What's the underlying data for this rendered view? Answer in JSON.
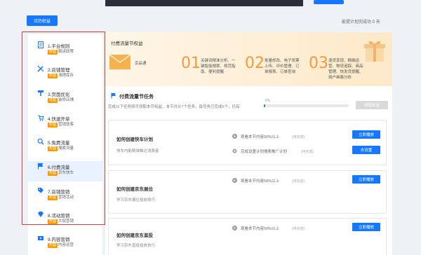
{
  "top": {
    "primary_button": "日历权益",
    "right_text": "能提计划完成功 0 天"
  },
  "sidebar": {
    "items": [
      {
        "title": "1.平台规则",
        "tag": "权益",
        "sub": "解读政策",
        "icon": "document-icon",
        "active": false
      },
      {
        "title": "2.店铺管理",
        "tag": "权益",
        "sub": "清理库存",
        "icon": "tools-icon",
        "active": false
      },
      {
        "title": "3.页面优化",
        "tag": "权益",
        "sub": "装修店铺",
        "icon": "brush-icon",
        "active": false
      },
      {
        "title": "4.快速开单",
        "tag": "权益",
        "sub": "营销获客",
        "icon": "cart-icon",
        "active": false
      },
      {
        "title": "5.免费流量",
        "tag": "权益",
        "sub": "搜索流量",
        "icon": "search-icon",
        "active": false
      },
      {
        "title": "6.付费流量",
        "tag": "权益",
        "sub": "京东快车",
        "icon": "flag-icon",
        "active": true
      },
      {
        "title": "7.店铺营销",
        "tag": "权益",
        "sub": "营销活动",
        "icon": "tag-icon",
        "active": false
      },
      {
        "title": "8.活动营销",
        "tag": "权益",
        "sub": "大促营销",
        "icon": "diamond-icon",
        "active": false
      },
      {
        "title": "9.内容营销",
        "tag": "权益",
        "sub": "内容运营",
        "icon": "video-icon",
        "active": false
      }
    ]
  },
  "hero": {
    "title": "付费流量节权益",
    "jd_label": "京品通",
    "steps": [
      {
        "num": "01",
        "text": "关键词精准分析、一键智能搜索、规范指南、便利提醒"
      },
      {
        "num": "02",
        "text": "批量修改、电子发票上传、评价管理、订单报表、订单查询"
      },
      {
        "num": "03",
        "text": "退货变现、精细运营、物流追踪、商品管理、快发货提醒、用户画像分析"
      }
    ]
  },
  "section": {
    "title": "付费流量节任务",
    "desc": "完成以下任务即可领取本节权益，本节共计7个任务，每任务已完成5个，仍有",
    "progress_label": "0%",
    "progress": 0.02,
    "claim_button": "领取权益"
  },
  "tasks": [
    {
      "title": "如何创建快车计划",
      "desc": "快车内能精准触达消费者",
      "requirements": [
        {
          "text": "观看本节内容50%以上",
          "status": "(待完成)"
        },
        {
          "text": "完成设置计划搜索推广计划",
          "status": "(待完成)"
        }
      ],
      "buttons": [
        "立即播放",
        "去设置"
      ]
    },
    {
      "title": "如何创建京东展位",
      "desc": "学习京东展位投放技巧",
      "requirements": [
        {
          "text": "观看本节内容50%以上",
          "status": "(待完成)"
        }
      ],
      "buttons": [
        "立即播放"
      ]
    },
    {
      "title": "如何创建京东直投",
      "desc": "学习京东直投投放技巧",
      "requirements": [
        {
          "text": "观看本节内容50%以上",
          "status": "(待完成)"
        }
      ],
      "buttons": [
        "立即播放"
      ]
    }
  ],
  "colors": {
    "accent": "#1677ff",
    "tag": "#ff9900",
    "hero_number": "#f19a3e",
    "frame": "#e23b2e"
  }
}
